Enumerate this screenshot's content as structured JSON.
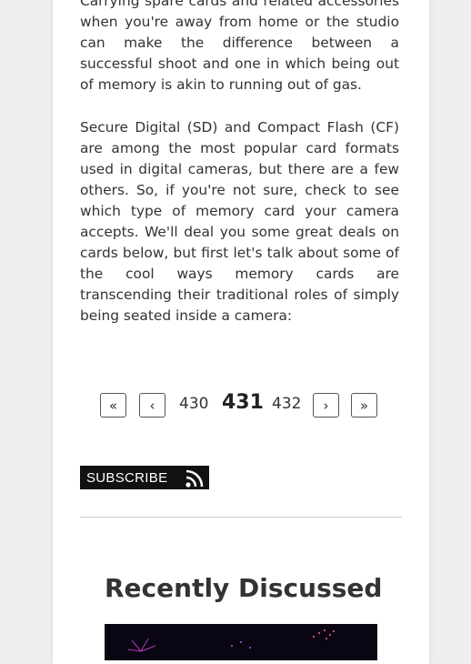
{
  "article": {
    "paragraph_1": "Carrying spare cards and related accessories when you're away from home or the studio can make the difference between a successful shoot and one in which being out of memory is akin to running out of gas.",
    "paragraph_2": "Secure Digital (SD) and Compact Flash (CF) are among the most popular card formats used in digital cameras, but there are a few others. So, if you're not sure, check to see which type of memory card your camera accepts. We'll deal you some great deals on cards below, but first let's talk about some of the cool ways memory cards are transcending their traditional roles of simply being seated inside a camera:"
  },
  "pagination": {
    "first": "«",
    "prev": "‹",
    "page_prev": "430",
    "page_current": "431",
    "page_next": "432",
    "next": "›",
    "last": "»"
  },
  "subscribe": {
    "label": "SUBSCRIBE",
    "icon": "rss-icon"
  },
  "recent": {
    "heading": "Recently Discussed",
    "thumbnail_icon": "fireworks-image"
  },
  "colors": {
    "background": "#efefef",
    "card": "#ffffff",
    "text": "#333333",
    "subscribe_bg": "#111111"
  }
}
